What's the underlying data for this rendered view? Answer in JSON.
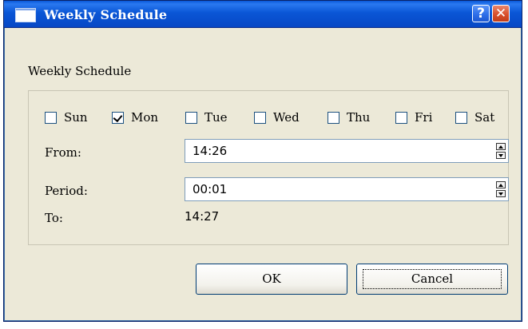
{
  "window": {
    "title": "Weekly Schedule",
    "help_glyph": "?",
    "close_glyph": "✕"
  },
  "dialog": {
    "label": "Weekly Schedule"
  },
  "days": [
    {
      "label": "Sun",
      "checked": false
    },
    {
      "label": "Mon",
      "checked": true
    },
    {
      "label": "Tue",
      "checked": false
    },
    {
      "label": "Wed",
      "checked": false
    },
    {
      "label": "Thu",
      "checked": false
    },
    {
      "label": "Fri",
      "checked": false
    },
    {
      "label": "Sat",
      "checked": false
    }
  ],
  "from": {
    "label": "From:",
    "value": "14:26"
  },
  "period": {
    "label": "Period:",
    "value": "00:01"
  },
  "to": {
    "label": "To:",
    "value": "14:27"
  },
  "buttons": {
    "ok": "OK",
    "cancel": "Cancel"
  },
  "colors": {
    "titlebar": "#0a56d6",
    "dialog_bg": "#ece9d8",
    "close_button": "#d9502c"
  }
}
